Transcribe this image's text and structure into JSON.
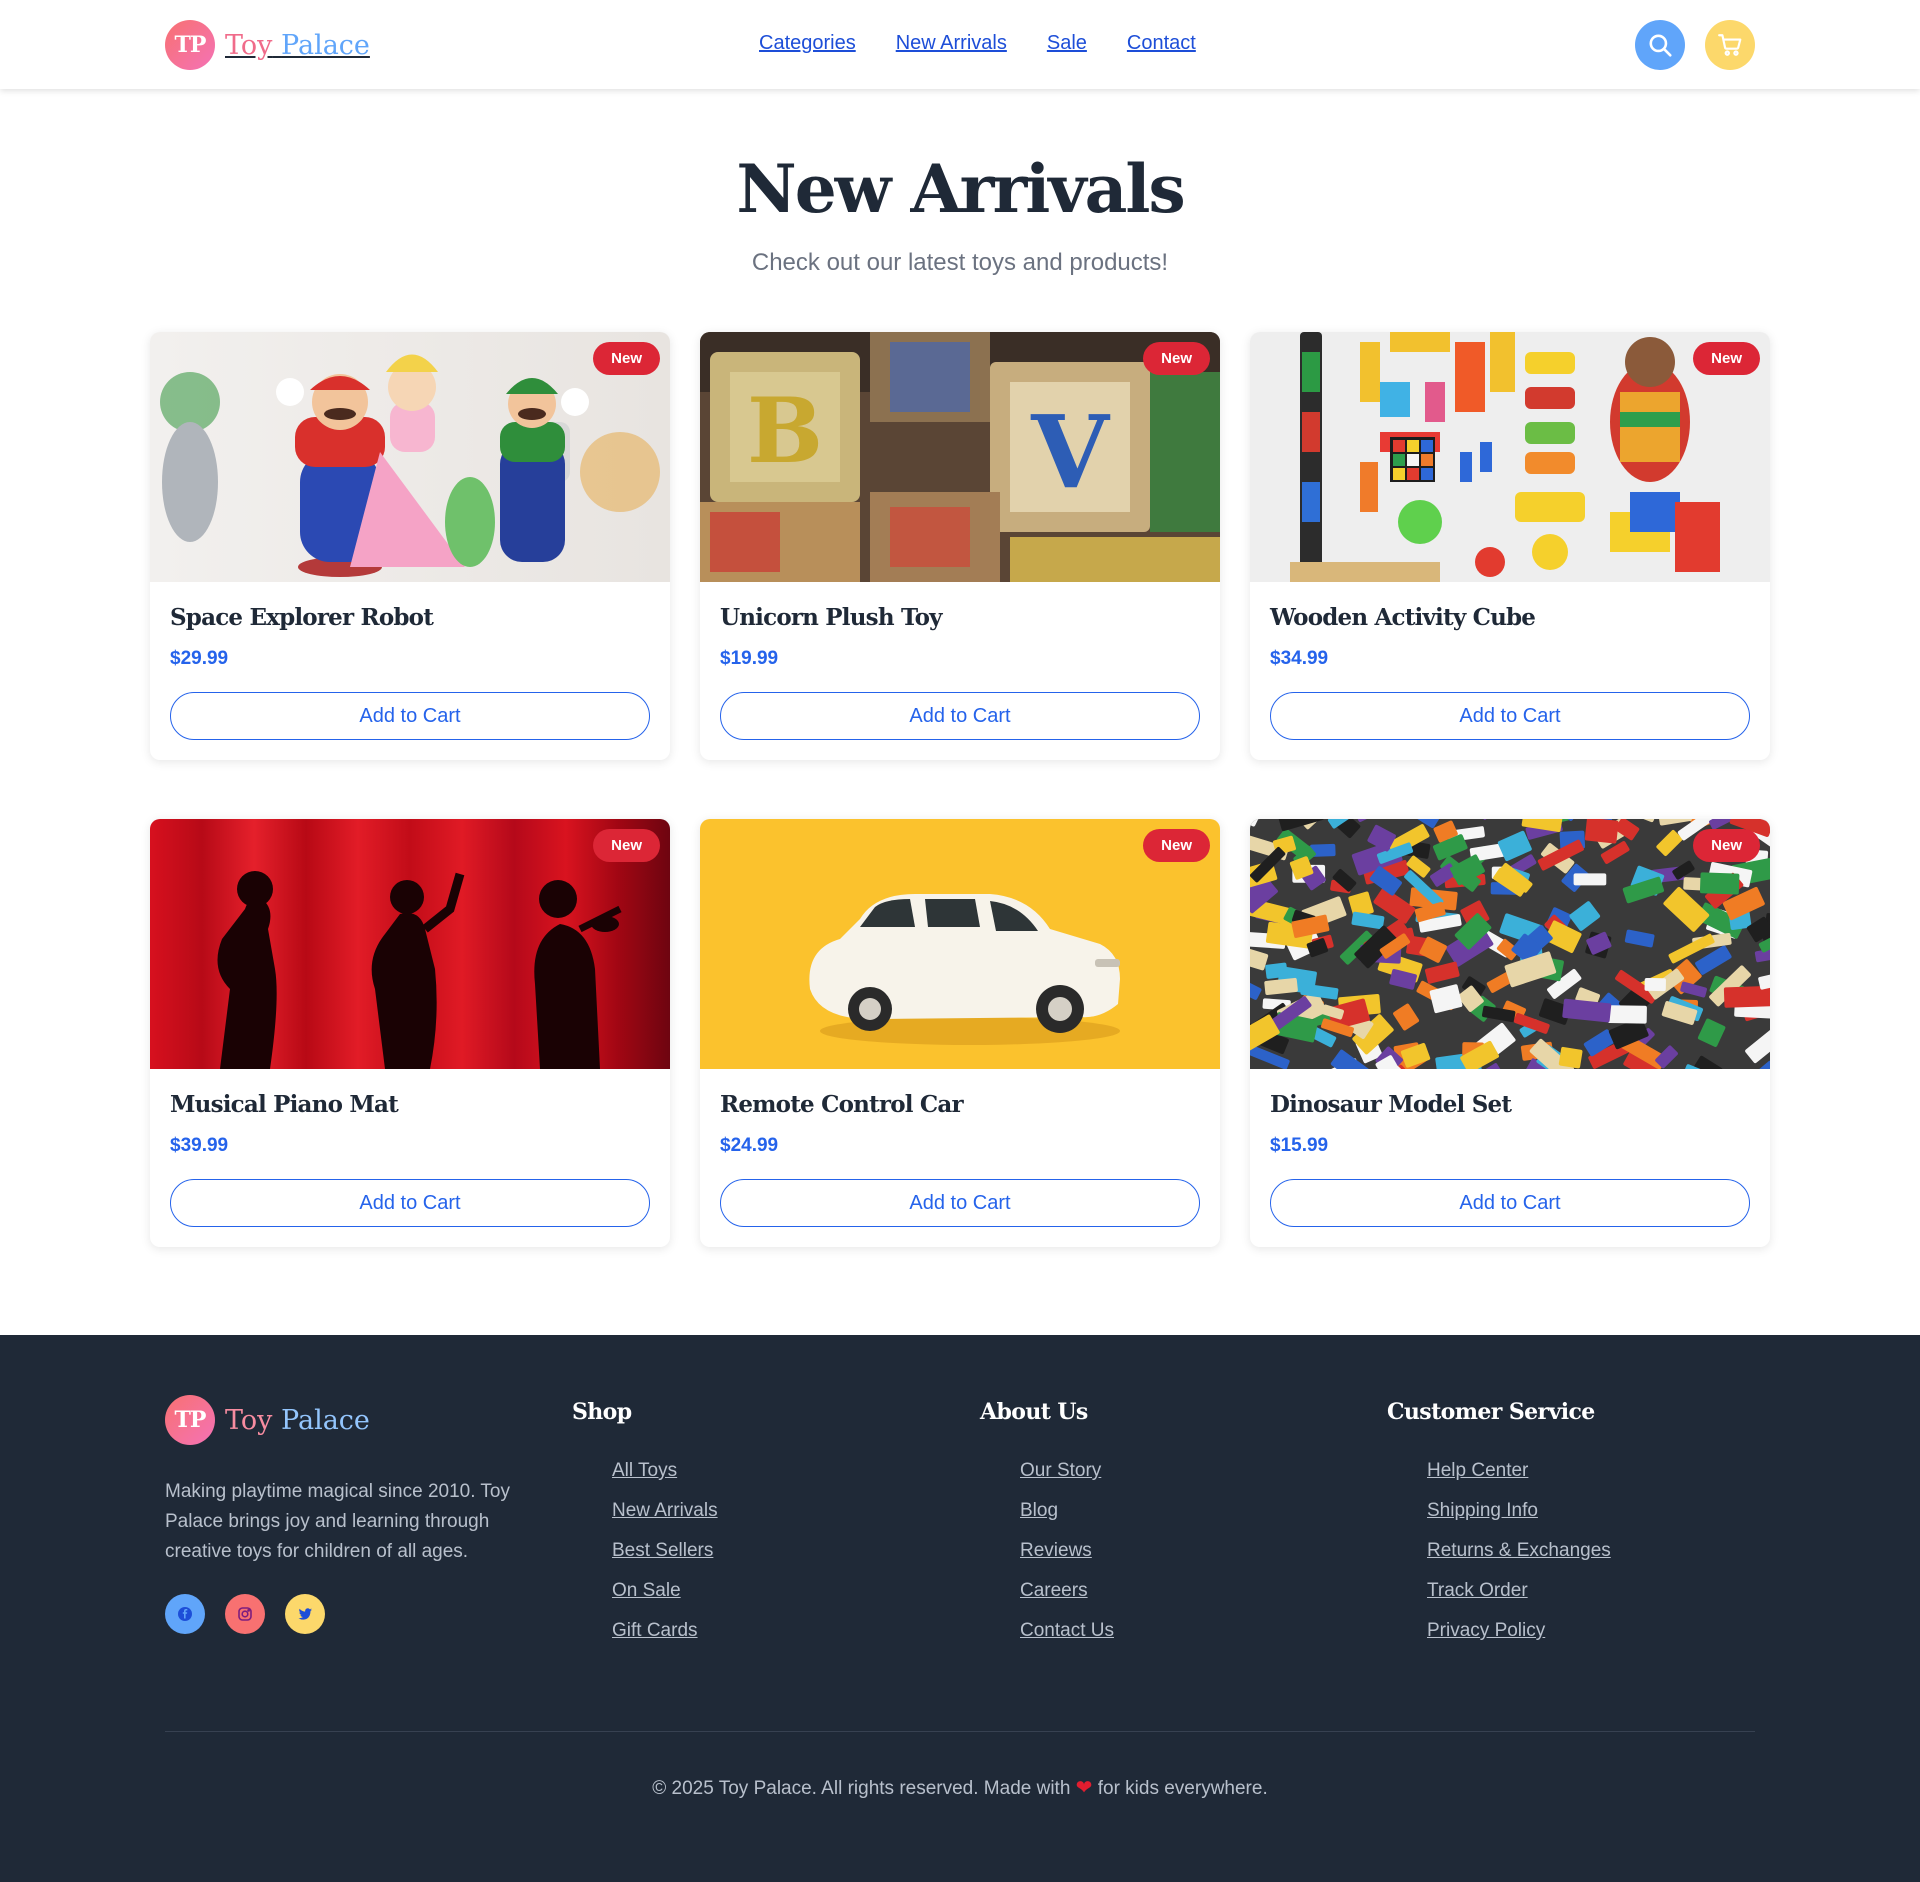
{
  "header": {
    "logo_initials": "TP",
    "logo_text_1": "Toy",
    "logo_text_2": "Palace",
    "nav": [
      "Categories",
      "New Arrivals",
      "Sale",
      "Contact"
    ],
    "search_icon": "search-icon",
    "cart_icon": "cart-icon"
  },
  "hero": {
    "title": "New Arrivals",
    "subtitle": "Check out our latest toys and products!"
  },
  "products": [
    {
      "name": "Space Explorer Robot",
      "price": "$29.99",
      "badge": "New",
      "button": "Add to Cart"
    },
    {
      "name": "Unicorn Plush Toy",
      "price": "$19.99",
      "badge": "New",
      "button": "Add to Cart"
    },
    {
      "name": "Wooden Activity Cube",
      "price": "$34.99",
      "badge": "New",
      "button": "Add to Cart"
    },
    {
      "name": "Musical Piano Mat",
      "price": "$39.99",
      "badge": "New",
      "button": "Add to Cart"
    },
    {
      "name": "Remote Control Car",
      "price": "$24.99",
      "badge": "New",
      "button": "Add to Cart"
    },
    {
      "name": "Dinosaur Model Set",
      "price": "$15.99",
      "badge": "New",
      "button": "Add to Cart"
    }
  ],
  "footer": {
    "logo_initials": "TP",
    "logo_text_1": "Toy",
    "logo_text_2": "Palace",
    "description": "Making playtime magical since 2010. Toy Palace brings joy and learning through creative toys for children of all ages.",
    "social_icons": [
      "facebook-icon",
      "instagram-icon",
      "twitter-icon"
    ],
    "columns": [
      {
        "title": "Shop",
        "links": [
          "All Toys",
          "New Arrivals",
          "Best Sellers",
          "On Sale",
          "Gift Cards"
        ]
      },
      {
        "title": "About Us",
        "links": [
          "Our Story",
          "Blog",
          "Reviews",
          "Careers",
          "Contact Us"
        ]
      },
      {
        "title": "Customer Service",
        "links": [
          "Help Center",
          "Shipping Info",
          "Returns & Exchanges",
          "Track Order",
          "Privacy Policy"
        ]
      }
    ],
    "copyright_pre": "© 2025 Toy Palace. All rights reserved. Made with",
    "copyright_post": "for kids everywhere."
  },
  "colors": {
    "accent_blue": "#2563eb",
    "badge_red": "#dc2636",
    "footer_bg": "#1f2937",
    "search_button": "#60a5fa",
    "cart_button": "#fcd86b"
  }
}
